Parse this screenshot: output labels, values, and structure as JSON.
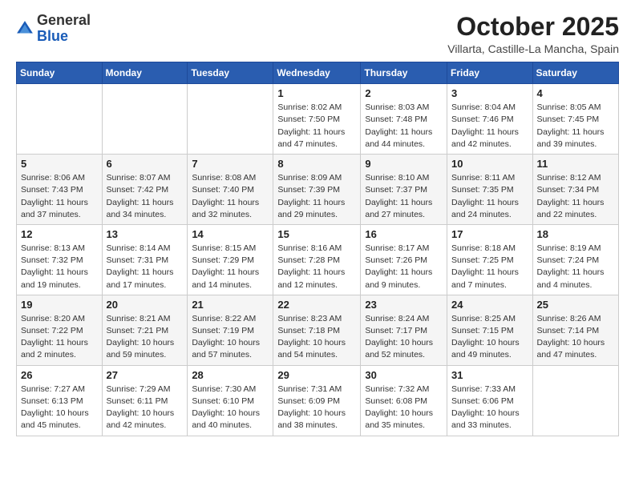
{
  "logo": {
    "general": "General",
    "blue": "Blue"
  },
  "header": {
    "month": "October 2025",
    "location": "Villarta, Castille-La Mancha, Spain"
  },
  "days_of_week": [
    "Sunday",
    "Monday",
    "Tuesday",
    "Wednesday",
    "Thursday",
    "Friday",
    "Saturday"
  ],
  "weeks": [
    [
      {
        "day": "",
        "info": ""
      },
      {
        "day": "",
        "info": ""
      },
      {
        "day": "",
        "info": ""
      },
      {
        "day": "1",
        "info": "Sunrise: 8:02 AM\nSunset: 7:50 PM\nDaylight: 11 hours and 47 minutes."
      },
      {
        "day": "2",
        "info": "Sunrise: 8:03 AM\nSunset: 7:48 PM\nDaylight: 11 hours and 44 minutes."
      },
      {
        "day": "3",
        "info": "Sunrise: 8:04 AM\nSunset: 7:46 PM\nDaylight: 11 hours and 42 minutes."
      },
      {
        "day": "4",
        "info": "Sunrise: 8:05 AM\nSunset: 7:45 PM\nDaylight: 11 hours and 39 minutes."
      }
    ],
    [
      {
        "day": "5",
        "info": "Sunrise: 8:06 AM\nSunset: 7:43 PM\nDaylight: 11 hours and 37 minutes."
      },
      {
        "day": "6",
        "info": "Sunrise: 8:07 AM\nSunset: 7:42 PM\nDaylight: 11 hours and 34 minutes."
      },
      {
        "day": "7",
        "info": "Sunrise: 8:08 AM\nSunset: 7:40 PM\nDaylight: 11 hours and 32 minutes."
      },
      {
        "day": "8",
        "info": "Sunrise: 8:09 AM\nSunset: 7:39 PM\nDaylight: 11 hours and 29 minutes."
      },
      {
        "day": "9",
        "info": "Sunrise: 8:10 AM\nSunset: 7:37 PM\nDaylight: 11 hours and 27 minutes."
      },
      {
        "day": "10",
        "info": "Sunrise: 8:11 AM\nSunset: 7:35 PM\nDaylight: 11 hours and 24 minutes."
      },
      {
        "day": "11",
        "info": "Sunrise: 8:12 AM\nSunset: 7:34 PM\nDaylight: 11 hours and 22 minutes."
      }
    ],
    [
      {
        "day": "12",
        "info": "Sunrise: 8:13 AM\nSunset: 7:32 PM\nDaylight: 11 hours and 19 minutes."
      },
      {
        "day": "13",
        "info": "Sunrise: 8:14 AM\nSunset: 7:31 PM\nDaylight: 11 hours and 17 minutes."
      },
      {
        "day": "14",
        "info": "Sunrise: 8:15 AM\nSunset: 7:29 PM\nDaylight: 11 hours and 14 minutes."
      },
      {
        "day": "15",
        "info": "Sunrise: 8:16 AM\nSunset: 7:28 PM\nDaylight: 11 hours and 12 minutes."
      },
      {
        "day": "16",
        "info": "Sunrise: 8:17 AM\nSunset: 7:26 PM\nDaylight: 11 hours and 9 minutes."
      },
      {
        "day": "17",
        "info": "Sunrise: 8:18 AM\nSunset: 7:25 PM\nDaylight: 11 hours and 7 minutes."
      },
      {
        "day": "18",
        "info": "Sunrise: 8:19 AM\nSunset: 7:24 PM\nDaylight: 11 hours and 4 minutes."
      }
    ],
    [
      {
        "day": "19",
        "info": "Sunrise: 8:20 AM\nSunset: 7:22 PM\nDaylight: 11 hours and 2 minutes."
      },
      {
        "day": "20",
        "info": "Sunrise: 8:21 AM\nSunset: 7:21 PM\nDaylight: 10 hours and 59 minutes."
      },
      {
        "day": "21",
        "info": "Sunrise: 8:22 AM\nSunset: 7:19 PM\nDaylight: 10 hours and 57 minutes."
      },
      {
        "day": "22",
        "info": "Sunrise: 8:23 AM\nSunset: 7:18 PM\nDaylight: 10 hours and 54 minutes."
      },
      {
        "day": "23",
        "info": "Sunrise: 8:24 AM\nSunset: 7:17 PM\nDaylight: 10 hours and 52 minutes."
      },
      {
        "day": "24",
        "info": "Sunrise: 8:25 AM\nSunset: 7:15 PM\nDaylight: 10 hours and 49 minutes."
      },
      {
        "day": "25",
        "info": "Sunrise: 8:26 AM\nSunset: 7:14 PM\nDaylight: 10 hours and 47 minutes."
      }
    ],
    [
      {
        "day": "26",
        "info": "Sunrise: 7:27 AM\nSunset: 6:13 PM\nDaylight: 10 hours and 45 minutes."
      },
      {
        "day": "27",
        "info": "Sunrise: 7:29 AM\nSunset: 6:11 PM\nDaylight: 10 hours and 42 minutes."
      },
      {
        "day": "28",
        "info": "Sunrise: 7:30 AM\nSunset: 6:10 PM\nDaylight: 10 hours and 40 minutes."
      },
      {
        "day": "29",
        "info": "Sunrise: 7:31 AM\nSunset: 6:09 PM\nDaylight: 10 hours and 38 minutes."
      },
      {
        "day": "30",
        "info": "Sunrise: 7:32 AM\nSunset: 6:08 PM\nDaylight: 10 hours and 35 minutes."
      },
      {
        "day": "31",
        "info": "Sunrise: 7:33 AM\nSunset: 6:06 PM\nDaylight: 10 hours and 33 minutes."
      },
      {
        "day": "",
        "info": ""
      }
    ]
  ]
}
